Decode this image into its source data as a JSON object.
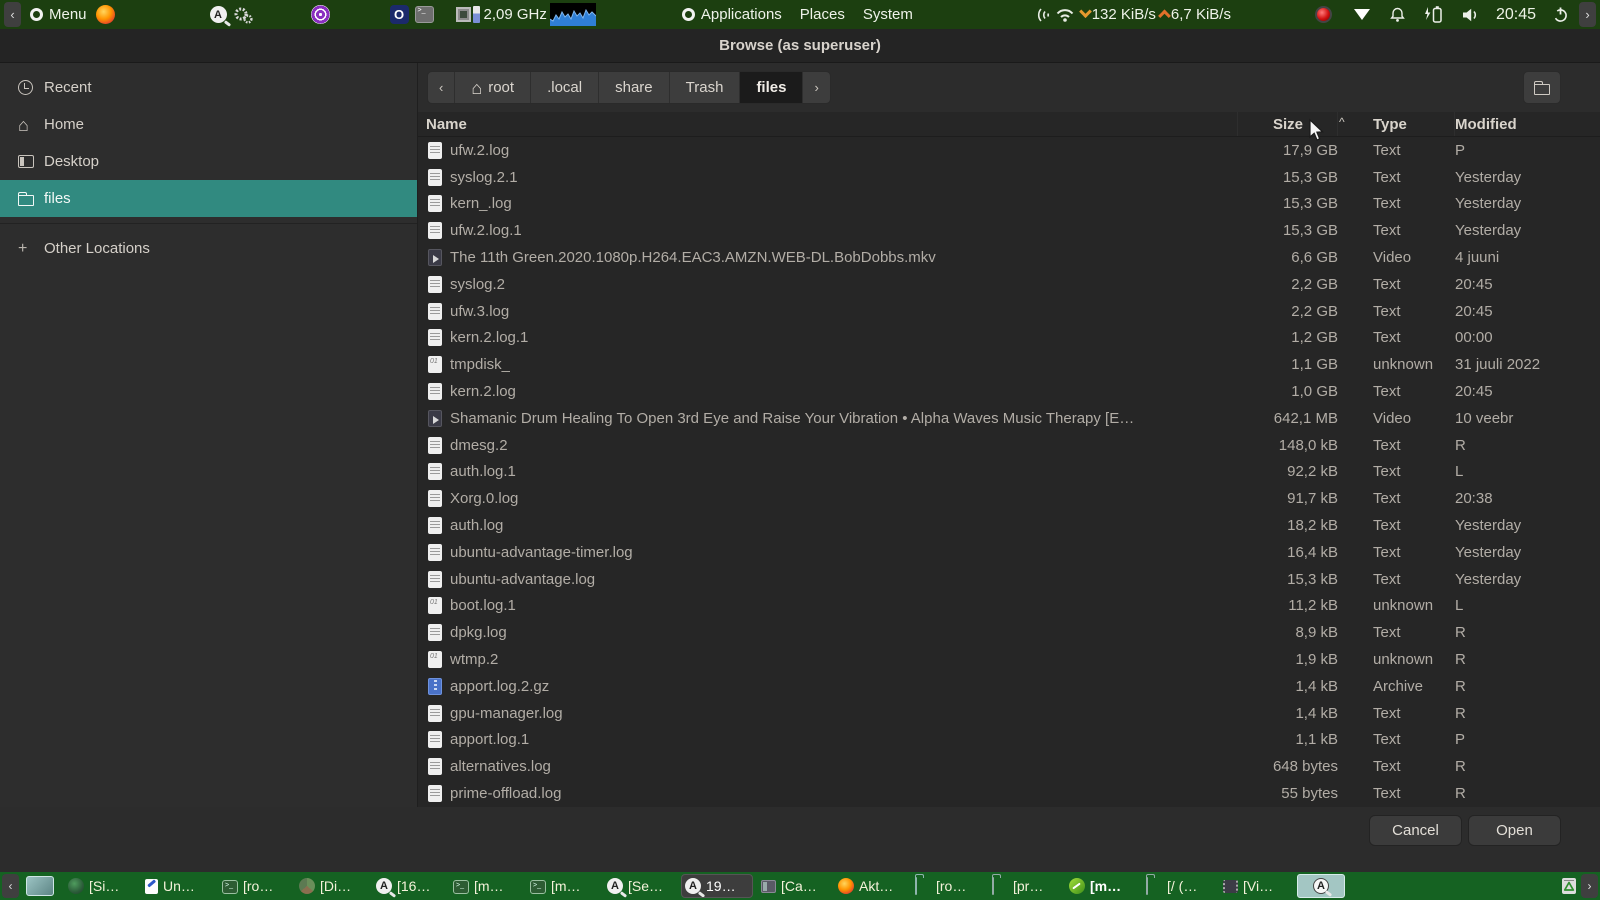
{
  "top_panel": {
    "nav_left": "‹",
    "menu_label": "Menu",
    "cpu_freq": "2,09 GHz",
    "menu_applications": "Applications",
    "menu_places": "Places",
    "menu_system": "System",
    "net_down": "132 KiB/s",
    "net_up": "6,7 KiB/s",
    "clock": "20:45",
    "nav_right": "›",
    "panel_bg": "#1c3f10"
  },
  "dialog": {
    "title": "Browse (as superuser)",
    "pathbar": {
      "back": "‹",
      "forward": "›",
      "crumbs": [
        {
          "label": "root",
          "icon": "home"
        },
        {
          "label": ".local"
        },
        {
          "label": "share"
        },
        {
          "label": "Trash"
        },
        {
          "label": "files",
          "active": true
        }
      ]
    },
    "sidebar": {
      "items": [
        {
          "label": "Recent",
          "icon": "recent"
        },
        {
          "label": "Home",
          "icon": "home"
        },
        {
          "label": "Desktop",
          "icon": "desktop"
        },
        {
          "label": "files",
          "icon": "folder",
          "selected": true
        },
        {
          "label": "Other Locations",
          "icon": "plus"
        }
      ],
      "selected_color": "#318a80"
    },
    "columns": {
      "name": "Name",
      "size": "Size",
      "type": "Type",
      "modified": "Modified",
      "sort_indicator": "^",
      "sorted_by": "Size"
    },
    "files": [
      {
        "name": "ufw.2.log",
        "size": "17,9 GB",
        "type": "Text",
        "modified": "P",
        "icon": "text"
      },
      {
        "name": "syslog.2.1",
        "size": "15,3 GB",
        "type": "Text",
        "modified": "Yesterday",
        "icon": "text"
      },
      {
        "name": "kern_.log",
        "size": "15,3 GB",
        "type": "Text",
        "modified": "Yesterday",
        "icon": "text"
      },
      {
        "name": "ufw.2.log.1",
        "size": "15,3 GB",
        "type": "Text",
        "modified": "Yesterday",
        "icon": "text"
      },
      {
        "name": "The 11th Green.2020.1080p.H264.EAC3.AMZN.WEB-DL.BobDobbs.mkv",
        "size": "6,6 GB",
        "type": "Video",
        "modified": "4 juuni",
        "icon": "video"
      },
      {
        "name": "syslog.2",
        "size": "2,2 GB",
        "type": "Text",
        "modified": "20:45",
        "icon": "text"
      },
      {
        "name": "ufw.3.log",
        "size": "2,2 GB",
        "type": "Text",
        "modified": "20:45",
        "icon": "text"
      },
      {
        "name": "kern.2.log.1",
        "size": "1,2 GB",
        "type": "Text",
        "modified": "00:00",
        "icon": "text"
      },
      {
        "name": "tmpdisk_",
        "size": "1,1 GB",
        "type": "unknown",
        "modified": "31 juuli 2022",
        "icon": "binary"
      },
      {
        "name": "kern.2.log",
        "size": "1,0 GB",
        "type": "Text",
        "modified": "20:45",
        "icon": "text"
      },
      {
        "name": "Shamanic Drum Healing To Open 3rd Eye and Raise Your Vibration • Alpha Waves Music Therapy [E…",
        "size": "642,1 MB",
        "type": "Video",
        "modified": "10 veebr",
        "icon": "video"
      },
      {
        "name": "dmesg.2",
        "size": "148,0 kB",
        "type": "Text",
        "modified": "R",
        "icon": "text"
      },
      {
        "name": "auth.log.1",
        "size": "92,2 kB",
        "type": "Text",
        "modified": "L",
        "icon": "text"
      },
      {
        "name": "Xorg.0.log",
        "size": "91,7 kB",
        "type": "Text",
        "modified": "20:38",
        "icon": "text"
      },
      {
        "name": "auth.log",
        "size": "18,2 kB",
        "type": "Text",
        "modified": "Yesterday",
        "icon": "text"
      },
      {
        "name": "ubuntu-advantage-timer.log",
        "size": "16,4 kB",
        "type": "Text",
        "modified": "Yesterday",
        "icon": "text"
      },
      {
        "name": "ubuntu-advantage.log",
        "size": "15,3 kB",
        "type": "Text",
        "modified": "Yesterday",
        "icon": "text"
      },
      {
        "name": "boot.log.1",
        "size": "11,2 kB",
        "type": "unknown",
        "modified": "L",
        "icon": "binary"
      },
      {
        "name": "dpkg.log",
        "size": "8,9 kB",
        "type": "Text",
        "modified": "R",
        "icon": "text"
      },
      {
        "name": "wtmp.2",
        "size": "1,9 kB",
        "type": "unknown",
        "modified": "R",
        "icon": "binary"
      },
      {
        "name": "apport.log.2.gz",
        "size": "1,4 kB",
        "type": "Archive",
        "modified": "R",
        "icon": "archive"
      },
      {
        "name": "gpu-manager.log",
        "size": "1,4 kB",
        "type": "Text",
        "modified": "R",
        "icon": "text"
      },
      {
        "name": "apport.log.1",
        "size": "1,1 kB",
        "type": "Text",
        "modified": "P",
        "icon": "text"
      },
      {
        "name": "alternatives.log",
        "size": "648 bytes",
        "type": "Text",
        "modified": "R",
        "icon": "text"
      },
      {
        "name": "prime-offload.log",
        "size": "55 bytes",
        "type": "Text",
        "modified": "R",
        "icon": "text"
      }
    ],
    "actions": {
      "cancel": "Cancel",
      "open": "Open"
    }
  },
  "taskbar": {
    "nav_left": "‹",
    "nav_right": "›",
    "windows": [
      {
        "label": "[Si…",
        "icon": "globe"
      },
      {
        "label": "Un…",
        "icon": "note"
      },
      {
        "label": "[ro…",
        "icon": "terminal"
      },
      {
        "label": "[Di…",
        "icon": "pie-chart"
      },
      {
        "label": "[16…",
        "icon": "magnifier"
      },
      {
        "label": "[m…",
        "icon": "terminal"
      },
      {
        "label": "[m…",
        "icon": "terminal"
      },
      {
        "label": "[Se…",
        "icon": "magnifier"
      },
      {
        "label": "19…",
        "icon": "magnifier",
        "state": "active"
      },
      {
        "label": "[Ca…",
        "icon": "panel"
      },
      {
        "label": "Akt…",
        "icon": "firefox"
      },
      {
        "label": "[ro…",
        "icon": "home-folder"
      },
      {
        "label": "[pr…",
        "icon": "folder"
      },
      {
        "label": "[m…",
        "icon": "leaf",
        "state": "attention"
      },
      {
        "label": "[/ (…",
        "icon": "folder"
      },
      {
        "label": "[Vi…",
        "icon": "film"
      }
    ],
    "tool_button": {
      "icon": "magnifier",
      "state": "pressed"
    },
    "bar_bg": "#156222"
  }
}
